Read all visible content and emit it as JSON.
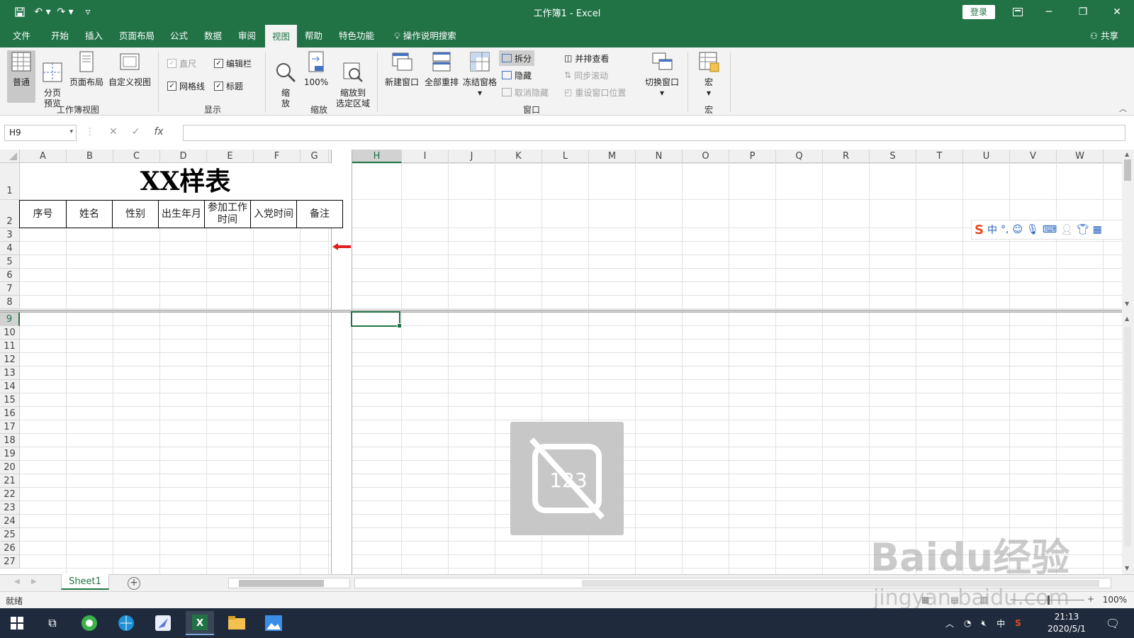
{
  "title_bar": {
    "title": "工作簿1  -  Excel",
    "login": "登录"
  },
  "menu": {
    "tabs": [
      "文件",
      "开始",
      "插入",
      "页面布局",
      "公式",
      "数据",
      "审阅",
      "视图",
      "帮助",
      "特色功能"
    ],
    "active_tab": "视图",
    "search": "操作说明搜索",
    "share": "共享"
  },
  "ribbon": {
    "workbook_views": {
      "label": "工作簿视图",
      "normal": "普通",
      "page_break": "分页\n预览",
      "page_layout": "页面布局",
      "custom": "自定义视图"
    },
    "show": {
      "label": "显示",
      "ruler": "直尺",
      "formula_bar": "编辑栏",
      "gridlines": "网格线",
      "headings": "标题"
    },
    "zoom": {
      "label": "缩放",
      "zoom": "缩\n放",
      "zoom100": "100%",
      "zoom_selection": "缩放到\n选定区域"
    },
    "window": {
      "label": "窗口",
      "new_window": "新建窗口",
      "arrange_all": "全部重排",
      "freeze": "冻结窗格",
      "split": "拆分",
      "hide": "隐藏",
      "unhide": "取消隐藏",
      "side_by_side": "并排查看",
      "sync_scroll": "同步滚动",
      "reset_position": "重设窗口位置",
      "switch_windows": "切换窗口"
    },
    "macros": {
      "label": "宏",
      "macros": "宏"
    }
  },
  "formula_bar": {
    "name_box": "H9",
    "formula": ""
  },
  "sheet": {
    "columns": [
      "A",
      "B",
      "C",
      "D",
      "E",
      "F",
      "G",
      "H",
      "I",
      "J",
      "K",
      "L",
      "M",
      "N",
      "O",
      "P",
      "Q",
      "R",
      "S",
      "T",
      "U",
      "V",
      "W"
    ],
    "selected_column": "H",
    "rows": [
      "1",
      "2",
      "3",
      "4",
      "5",
      "6",
      "7",
      "8",
      "9",
      "10",
      "11",
      "12",
      "13",
      "14",
      "15",
      "16",
      "17",
      "18",
      "19",
      "20",
      "21",
      "22",
      "23",
      "24",
      "25",
      "26",
      "27"
    ],
    "selected_row": "9",
    "title": "XX样表",
    "headers": [
      "序号",
      "姓名",
      "性别",
      "出生年月",
      "参加工作时间",
      "入党时间",
      "备注"
    ]
  },
  "ime_toolbar": {
    "logo": "S",
    "mode": "中",
    "punct": "°,"
  },
  "sheet_tabs": {
    "active": "Sheet1",
    "add": "+"
  },
  "status": {
    "ready": "就绪",
    "zoom": "100%"
  },
  "watermark": {
    "brand": "Baidu经验",
    "url": "jingyan.baidu.com"
  },
  "taskbar": {
    "ime": "中",
    "time": "21:13",
    "date": "2020/5/1"
  },
  "colors": {
    "excel_green": "#217346",
    "taskbar": "#1f2b3d"
  }
}
